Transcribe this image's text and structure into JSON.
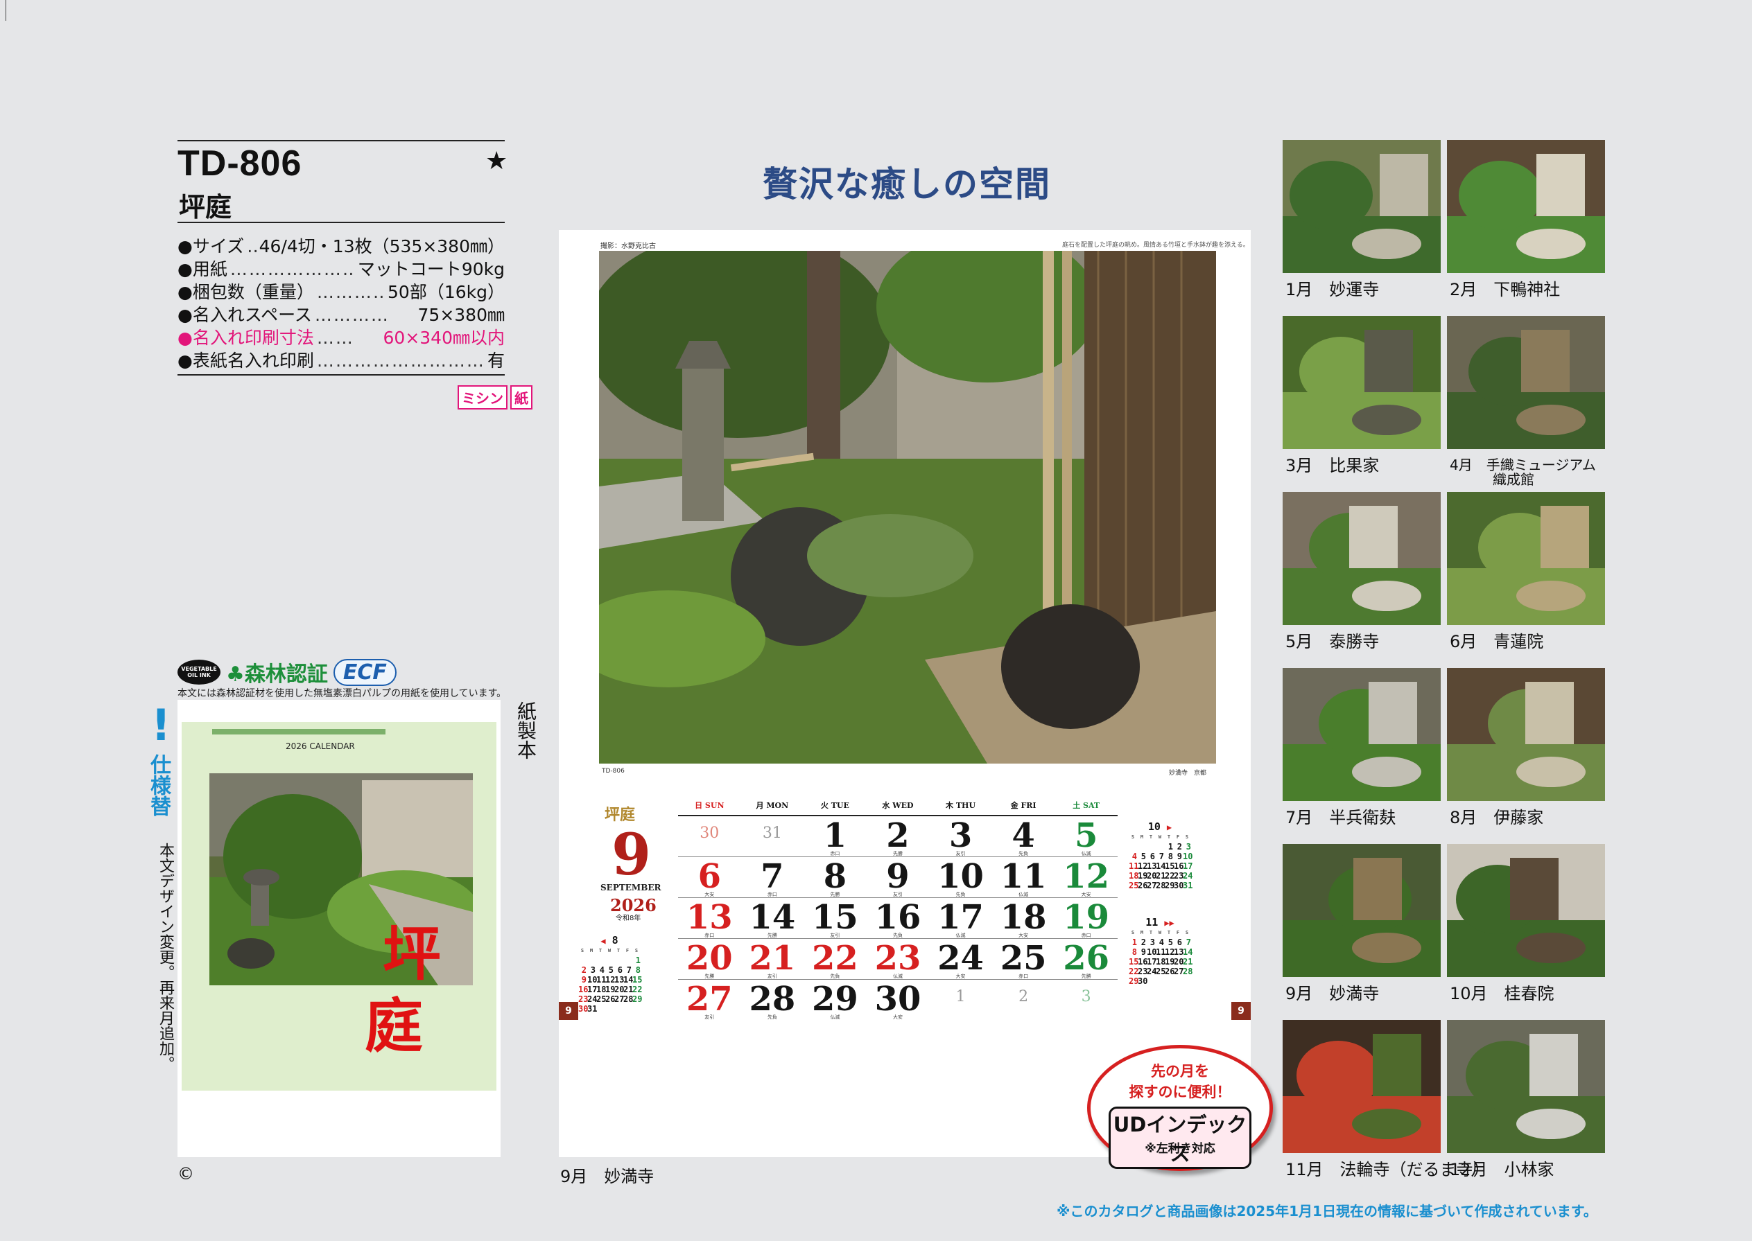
{
  "product": {
    "code": "TD-806",
    "name": "坪庭",
    "star": "★"
  },
  "specs": [
    {
      "label": "●サイズ",
      "dots": "…",
      "value": "46/4切・13枚（535×380㎜）",
      "highlight": false
    },
    {
      "label": "●用紙",
      "dots": "……………………",
      "value": "マットコート90kg",
      "highlight": false
    },
    {
      "label": "●梱包数（重量）",
      "dots": "…………",
      "value": "50部（16kg）",
      "highlight": false
    },
    {
      "label": "●名入れスペース",
      "dots": "…………",
      "value": "75×380㎜",
      "highlight": false
    },
    {
      "label": "●名入れ印刷寸法",
      "dots": "……",
      "value": "60×340㎜以内",
      "highlight": true
    },
    {
      "label": "●表紙名入れ印刷",
      "dots": "………………………………",
      "value": "有",
      "highlight": false
    }
  ],
  "badges": [
    "ミシン",
    "紙"
  ],
  "eco": {
    "vegetable_ink": "VEGETABLE OIL INK",
    "forest": "森林認証",
    "ecf": "ECF",
    "note": "本文には森林認証材を使用した無塩素漂白パルプの用紙を使用しています。"
  },
  "cover": {
    "calendar_label": "2026 CALENDAR",
    "title_line1": "坪",
    "title_line2": "庭"
  },
  "notice": {
    "mark": "!",
    "label": "仕様替",
    "text": "本文デザイン変更。再来月追加。"
  },
  "binding": "紙製本",
  "copyright": "©",
  "headline": "贅沢な癒しの空間",
  "sheet": {
    "photo_credit": "撮影：水野克比古",
    "photo_caption_top": "庭石を配置した坪庭の眺め。風情ある竹垣と手水鉢が趣を添える。",
    "code": "TD-806",
    "location": "妙満寺　京都",
    "brand": "坪庭",
    "month": "9",
    "month_en": "SEPTEMBER",
    "year": "2026",
    "era": "令和8年",
    "tag": "9"
  },
  "calendar": {
    "dow": [
      {
        "jp": "日",
        "en": "SUN",
        "color": "c-red"
      },
      {
        "jp": "月",
        "en": "MON",
        "color": "c-black"
      },
      {
        "jp": "火",
        "en": "TUE",
        "color": "c-black"
      },
      {
        "jp": "水",
        "en": "WED",
        "color": "c-black"
      },
      {
        "jp": "木",
        "en": "THU",
        "color": "c-black"
      },
      {
        "jp": "金",
        "en": "FRI",
        "color": "c-black"
      },
      {
        "jp": "土",
        "en": "SAT",
        "color": "c-green"
      }
    ],
    "weeks": [
      [
        {
          "d": "30",
          "c": "c-salmon",
          "s": true
        },
        {
          "d": "31",
          "c": "c-grey",
          "s": true
        },
        {
          "d": "1",
          "c": "c-black",
          "r": "赤口"
        },
        {
          "d": "2",
          "c": "c-black",
          "r": "先勝"
        },
        {
          "d": "3",
          "c": "c-black",
          "r": "友引"
        },
        {
          "d": "4",
          "c": "c-black",
          "r": "先負"
        },
        {
          "d": "5",
          "c": "c-green",
          "r": "仏滅"
        }
      ],
      [
        {
          "d": "6",
          "c": "c-red",
          "r": "大安"
        },
        {
          "d": "7",
          "c": "c-black",
          "r": "赤口"
        },
        {
          "d": "8",
          "c": "c-black",
          "r": "先勝"
        },
        {
          "d": "9",
          "c": "c-black",
          "r": "友引"
        },
        {
          "d": "10",
          "c": "c-black",
          "r": "先負"
        },
        {
          "d": "11",
          "c": "c-black",
          "r": "仏滅"
        },
        {
          "d": "12",
          "c": "c-green",
          "r": "大安"
        }
      ],
      [
        {
          "d": "13",
          "c": "c-red",
          "r": "赤口"
        },
        {
          "d": "14",
          "c": "c-black",
          "r": "先勝"
        },
        {
          "d": "15",
          "c": "c-black",
          "r": "友引"
        },
        {
          "d": "16",
          "c": "c-black",
          "r": "先負"
        },
        {
          "d": "17",
          "c": "c-black",
          "r": "仏滅"
        },
        {
          "d": "18",
          "c": "c-black",
          "r": "大安"
        },
        {
          "d": "19",
          "c": "c-green",
          "r": "赤口"
        }
      ],
      [
        {
          "d": "20",
          "c": "c-red",
          "r": "先勝"
        },
        {
          "d": "21",
          "c": "c-red",
          "r": "友引"
        },
        {
          "d": "22",
          "c": "c-red",
          "r": "先負"
        },
        {
          "d": "23",
          "c": "c-red",
          "r": "仏滅"
        },
        {
          "d": "24",
          "c": "c-black",
          "r": "大安"
        },
        {
          "d": "25",
          "c": "c-black",
          "r": "赤口"
        },
        {
          "d": "26",
          "c": "c-green",
          "r": "先勝"
        }
      ],
      [
        {
          "d": "27",
          "c": "c-red",
          "r": "友引"
        },
        {
          "d": "28",
          "c": "c-black",
          "r": "先負"
        },
        {
          "d": "29",
          "c": "c-black",
          "r": "仏滅"
        },
        {
          "d": "30",
          "c": "c-black",
          "r": "大安"
        },
        {
          "d": "1",
          "c": "c-grey",
          "s": true
        },
        {
          "d": "2",
          "c": "c-grey",
          "s": true
        },
        {
          "d": "3",
          "c": "c-lgreen",
          "s": true
        }
      ]
    ]
  },
  "mini_calendars": {
    "dow": [
      "S",
      "M",
      "T",
      "W",
      "T",
      "F",
      "S"
    ],
    "prev": {
      "month": "8",
      "arrow": "◀",
      "blanks": 6,
      "days": 31
    },
    "oct": {
      "month": "10",
      "arrow": "▶",
      "blanks": 4,
      "days": 31
    },
    "nov": {
      "month": "11",
      "arrow": "▶▶",
      "blanks": 0,
      "days": 30
    }
  },
  "ud_badge": {
    "line1": "先の月を",
    "line2": "探すのに便利！",
    "main": "UDインデックス",
    "note": "※左利き対応"
  },
  "main_caption": "9月　妙満寺",
  "thumbnails": [
    {
      "caption": "1月　妙運寺"
    },
    {
      "caption": "2月　下鴨神社"
    },
    {
      "caption": "3月　比果家"
    },
    {
      "caption": "4月　手織ミュージアム",
      "caption2": "織成館"
    },
    {
      "caption": "5月　泰勝寺"
    },
    {
      "caption": "6月　青蓮院"
    },
    {
      "caption": "7月　半兵衛麸"
    },
    {
      "caption": "8月　伊藤家"
    },
    {
      "caption": "9月　妙満寺"
    },
    {
      "caption": "10月　桂春院"
    },
    {
      "caption": "11月　法輪寺（だるま寺）"
    },
    {
      "caption": "12月　小林家"
    }
  ],
  "footnote": "※このカタログと商品画像は2025年1月1日現在の情報に基づいて作成されています。",
  "colors": {
    "accent_blue": "#1a8fcf",
    "headline_navy": "#2c4b86",
    "pink": "#e2157a",
    "red": "#d62020",
    "green": "#1a8a3a"
  }
}
